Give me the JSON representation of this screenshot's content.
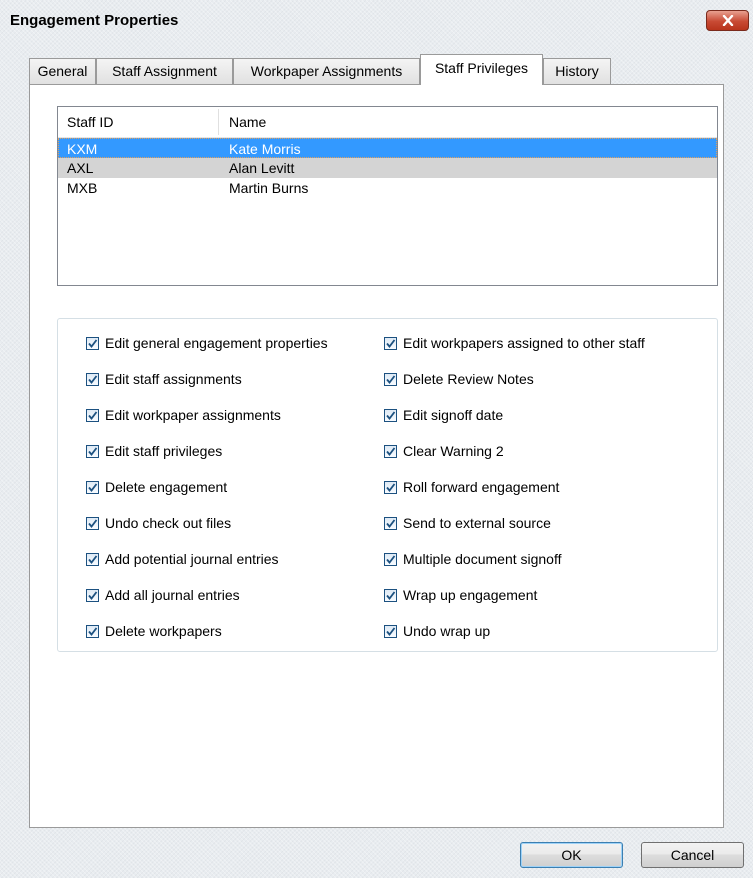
{
  "window": {
    "title": "Engagement Properties"
  },
  "tabs": [
    {
      "label": "General",
      "active": false
    },
    {
      "label": "Staff Assignment",
      "active": false
    },
    {
      "label": "Workpaper Assignments",
      "active": false
    },
    {
      "label": "Staff Privileges",
      "active": true
    },
    {
      "label": "History",
      "active": false
    }
  ],
  "staff_list": {
    "columns": [
      "Staff ID",
      "Name"
    ],
    "rows": [
      {
        "id": "KXM",
        "name": "Kate Morris",
        "selected": true
      },
      {
        "id": "AXL",
        "name": "Alan Levitt",
        "selected": false
      },
      {
        "id": "MXB",
        "name": "Martin Burns",
        "selected": false
      }
    ]
  },
  "privileges": {
    "left": [
      {
        "label": "Edit general engagement properties",
        "checked": true
      },
      {
        "label": "Edit staff assignments",
        "checked": true
      },
      {
        "label": "Edit workpaper assignments",
        "checked": true
      },
      {
        "label": "Edit staff privileges",
        "checked": true
      },
      {
        "label": "Delete engagement",
        "checked": true
      },
      {
        "label": "Undo check out files",
        "checked": true
      },
      {
        "label": "Add potential journal entries",
        "checked": true
      },
      {
        "label": "Add all journal entries",
        "checked": true
      },
      {
        "label": "Delete workpapers",
        "checked": true
      }
    ],
    "right": [
      {
        "label": "Edit workpapers assigned to other staff",
        "checked": true
      },
      {
        "label": "Delete Review Notes",
        "checked": true
      },
      {
        "label": "Edit signoff date",
        "checked": true
      },
      {
        "label": "Clear Warning 2",
        "checked": true
      },
      {
        "label": "Roll forward engagement",
        "checked": true
      },
      {
        "label": "Send to external source",
        "checked": true
      },
      {
        "label": "Multiple document signoff",
        "checked": true
      },
      {
        "label": "Wrap up engagement",
        "checked": true
      },
      {
        "label": "Undo wrap up",
        "checked": true
      }
    ]
  },
  "buttons": {
    "ok": "OK",
    "cancel": "Cancel"
  },
  "colors": {
    "selection": "#3399ff",
    "close_button": "#c84a34",
    "checkmark": "#1c5180"
  }
}
